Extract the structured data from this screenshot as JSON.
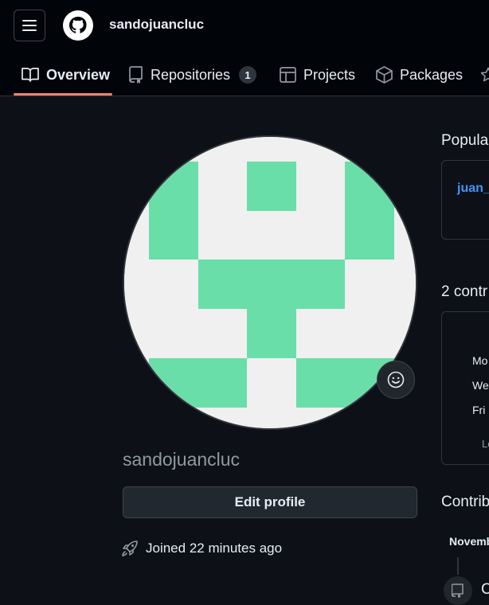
{
  "header": {
    "username": "sandojuancluc",
    "menu_icon": "hamburger-icon",
    "logo_icon": "github-logo-icon"
  },
  "tabs": [
    {
      "label": "Overview",
      "icon": "book-icon",
      "active": true
    },
    {
      "label": "Repositories",
      "icon": "repo-icon",
      "count": "1"
    },
    {
      "label": "Projects",
      "icon": "table-icon"
    },
    {
      "label": "Packages",
      "icon": "package-icon"
    },
    {
      "label": "",
      "icon": "star-icon"
    }
  ],
  "profile": {
    "login": "sandojuancluc",
    "edit_button": "Edit profile",
    "joined": "Joined 22 minutes ago",
    "avatar_color": "#69dea8"
  },
  "right": {
    "popular_title": "Popula",
    "repo_link": "juan_",
    "contrib_title": "2 contr",
    "days": [
      "Mo",
      "We",
      "Fri"
    ],
    "legend_less": "Le",
    "activity_title": "Contrib",
    "month": "Novemb",
    "activity_item": "C"
  },
  "colors": {
    "accent_underline": "#f78166",
    "link": "#4493f8",
    "bg": "#0d1117",
    "header_bg": "#010409"
  }
}
